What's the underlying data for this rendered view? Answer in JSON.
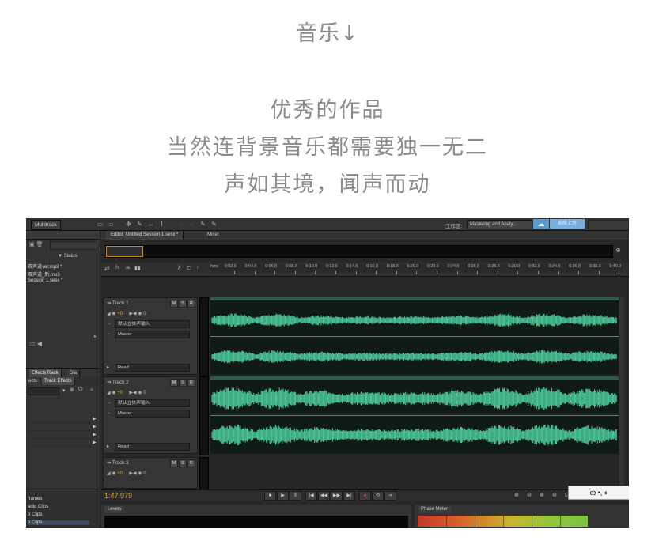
{
  "headline": "音乐↓",
  "lines": [
    "优秀的作品",
    "当然连背景音乐都需要独一无二",
    "声如其境，闻声而动"
  ],
  "app": {
    "mode_button": "Multitrack",
    "workspace_label": "工作区:",
    "workspace_value": "Mastering and Analy...",
    "cloud_button": "放映上传",
    "files_panel": {
      "status_header": "Status",
      "files": [
        "双声道ver.mp3 *",
        "双声道_新.mp3",
        "Session 1.sesx *"
      ]
    },
    "effects_panel": {
      "tabs": [
        "Effects Rack",
        "Dia"
      ],
      "subtabs": [
        "ects",
        "Track Effects"
      ]
    },
    "browser_items": [
      "frames",
      "adio Clips",
      "o Clips",
      "o Clips"
    ],
    "editor": {
      "tabs": [
        "Editor: Untitled Session 1.sesx *",
        "Mixer"
      ],
      "ruler_unit": "hms",
      "ruler_ticks": [
        "0:02.0",
        "0:04.0",
        "0:06.0",
        "0:08.0",
        "0:10.0",
        "0:12.0",
        "0:14.0",
        "0:16.0",
        "0:18.0",
        "0:20.0",
        "0:22.0",
        "0:24.0",
        "0:26.0",
        "0:28.0",
        "0:30.0",
        "0:32.0",
        "0:34.0",
        "0:36.0",
        "0:38.0",
        "0:40.0"
      ],
      "tracks": [
        {
          "name": "Track 1",
          "volume": "+0",
          "pan": "0",
          "input": "默认立体声输入",
          "output": "Master",
          "mode": "Read"
        },
        {
          "name": "Track 2",
          "volume": "+0",
          "pan": "0",
          "input": "默认立体声输入",
          "output": "Master",
          "mode": "Read"
        },
        {
          "name": "Track 3",
          "volume": "+0",
          "pan": "0"
        }
      ],
      "msr_labels": [
        "M",
        "S",
        "R"
      ],
      "time_display": "1:47.979",
      "levels_tab": "Levels",
      "phase_tab": "Phase Meter"
    },
    "popup_icons": "ф •, ◐"
  },
  "colors": {
    "waveform": "#4fd1a0",
    "time": "#e4a634",
    "accent": "#5b9bd5"
  }
}
